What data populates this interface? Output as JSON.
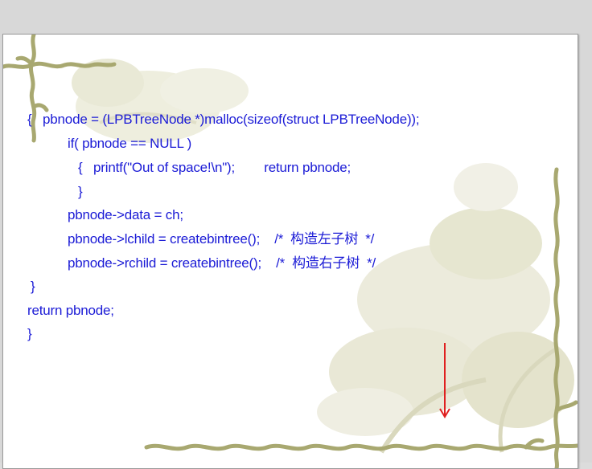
{
  "slide": {
    "code_lines": [
      "{   pbnode = (LPBTreeNode *)malloc(sizeof(struct LPBTreeNode));",
      "if( pbnode == NULL )",
      "{   printf(\"Out of space!\\n\");        return pbnode;",
      "}",
      "pbnode->data = ch;",
      "pbnode->lchild = createbintree();    /*  构造左子树  */",
      "pbnode->rchild = createbintree();    /*  构造右子树  */",
      "}",
      "return pbnode;",
      "}"
    ],
    "text_color": "#1b1bd6",
    "arrow_color": "#e02020",
    "decor_colors": {
      "vine": "#a8a870",
      "floral_wash": "#e7e7d2"
    },
    "decor_icons": [
      "vine-border-top-left-icon",
      "vine-border-right-icon",
      "vine-border-bottom-icon",
      "floral-background-icon",
      "down-arrow-icon"
    ]
  }
}
